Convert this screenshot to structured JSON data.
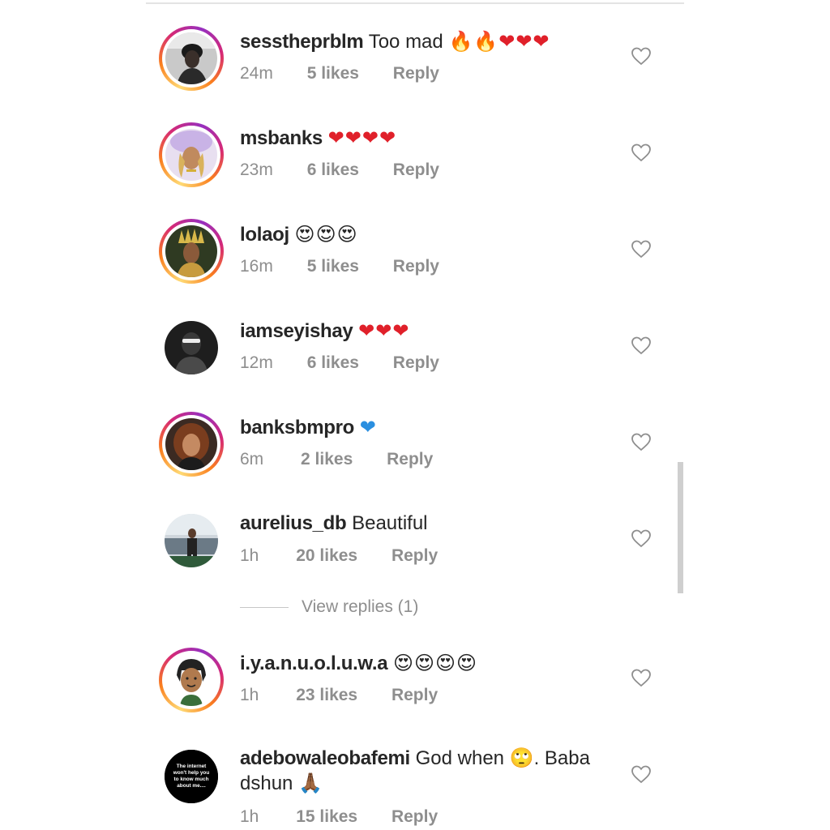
{
  "comments": [
    {
      "username": "sesstheprblm",
      "text": "Too mad",
      "emoji": "🔥🔥❤️❤️❤️",
      "time": "24m",
      "likes": "5 likes",
      "reply": "Reply",
      "avatar_ring": true
    },
    {
      "username": "msbanks",
      "text": "",
      "emoji": "❤️❤️❤️❤️",
      "time": "23m",
      "likes": "6 likes",
      "reply": "Reply",
      "avatar_ring": true
    },
    {
      "username": "lolaoj",
      "text": "",
      "emoji": "😍😍😍",
      "time": "16m",
      "likes": "5 likes",
      "reply": "Reply",
      "avatar_ring": true
    },
    {
      "username": "iamseyishay",
      "text": "",
      "emoji": "❤️❤️❤️",
      "time": "12m",
      "likes": "6 likes",
      "reply": "Reply",
      "avatar_ring": false
    },
    {
      "username": "banksbmpro",
      "text": "",
      "emoji": "💙",
      "time": "6m",
      "likes": "2 likes",
      "reply": "Reply",
      "avatar_ring": true
    },
    {
      "username": "aurelius_db",
      "text": "Beautiful",
      "emoji": "",
      "time": "1h",
      "likes": "20 likes",
      "reply": "Reply",
      "avatar_ring": false
    },
    {
      "username": "i.y.a.n.u.o.l.u.w.a",
      "text": "",
      "emoji": "😍😍😍😍",
      "time": "1h",
      "likes": "23 likes",
      "reply": "Reply",
      "avatar_ring": true
    },
    {
      "username": "adebowaleobafemi",
      "text": "God when 🙄. Baba dshun 🙏🏾",
      "emoji": "",
      "time": "1h",
      "likes": "15 likes",
      "reply": "Reply",
      "avatar_ring": false
    }
  ],
  "view_replies": "View replies (1)",
  "avatar_text_last": "The internet won't help you to know much about me....",
  "colors": {
    "text": "#262626",
    "meta": "#8e8e8e",
    "heart_red": "#e0202a",
    "heart_blue": "#2b8fe0"
  },
  "icons": {
    "like": "heart-outline-icon"
  }
}
